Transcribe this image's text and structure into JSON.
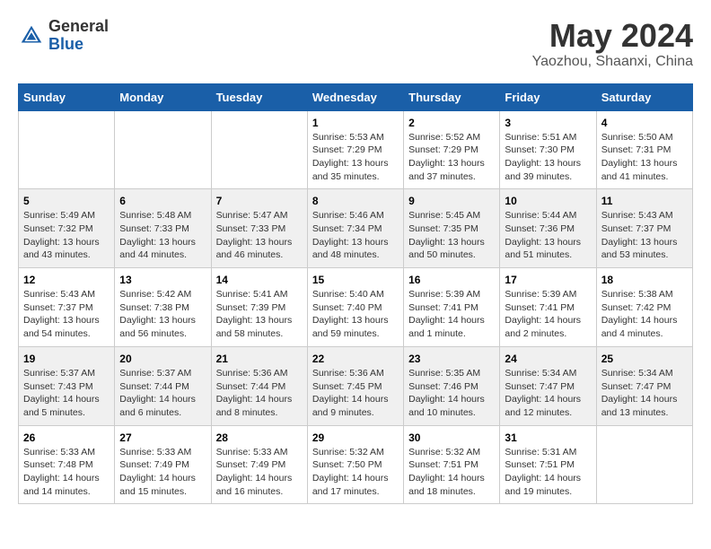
{
  "header": {
    "logo_general": "General",
    "logo_blue": "Blue",
    "main_title": "May 2024",
    "sub_title": "Yaozhou, Shaanxi, China"
  },
  "weekdays": [
    "Sunday",
    "Monday",
    "Tuesday",
    "Wednesday",
    "Thursday",
    "Friday",
    "Saturday"
  ],
  "weeks": [
    [
      {
        "day": "",
        "info": ""
      },
      {
        "day": "",
        "info": ""
      },
      {
        "day": "",
        "info": ""
      },
      {
        "day": "1",
        "info": "Sunrise: 5:53 AM\nSunset: 7:29 PM\nDaylight: 13 hours\nand 35 minutes."
      },
      {
        "day": "2",
        "info": "Sunrise: 5:52 AM\nSunset: 7:29 PM\nDaylight: 13 hours\nand 37 minutes."
      },
      {
        "day": "3",
        "info": "Sunrise: 5:51 AM\nSunset: 7:30 PM\nDaylight: 13 hours\nand 39 minutes."
      },
      {
        "day": "4",
        "info": "Sunrise: 5:50 AM\nSunset: 7:31 PM\nDaylight: 13 hours\nand 41 minutes."
      }
    ],
    [
      {
        "day": "5",
        "info": "Sunrise: 5:49 AM\nSunset: 7:32 PM\nDaylight: 13 hours\nand 43 minutes."
      },
      {
        "day": "6",
        "info": "Sunrise: 5:48 AM\nSunset: 7:33 PM\nDaylight: 13 hours\nand 44 minutes."
      },
      {
        "day": "7",
        "info": "Sunrise: 5:47 AM\nSunset: 7:33 PM\nDaylight: 13 hours\nand 46 minutes."
      },
      {
        "day": "8",
        "info": "Sunrise: 5:46 AM\nSunset: 7:34 PM\nDaylight: 13 hours\nand 48 minutes."
      },
      {
        "day": "9",
        "info": "Sunrise: 5:45 AM\nSunset: 7:35 PM\nDaylight: 13 hours\nand 50 minutes."
      },
      {
        "day": "10",
        "info": "Sunrise: 5:44 AM\nSunset: 7:36 PM\nDaylight: 13 hours\nand 51 minutes."
      },
      {
        "day": "11",
        "info": "Sunrise: 5:43 AM\nSunset: 7:37 PM\nDaylight: 13 hours\nand 53 minutes."
      }
    ],
    [
      {
        "day": "12",
        "info": "Sunrise: 5:43 AM\nSunset: 7:37 PM\nDaylight: 13 hours\nand 54 minutes."
      },
      {
        "day": "13",
        "info": "Sunrise: 5:42 AM\nSunset: 7:38 PM\nDaylight: 13 hours\nand 56 minutes."
      },
      {
        "day": "14",
        "info": "Sunrise: 5:41 AM\nSunset: 7:39 PM\nDaylight: 13 hours\nand 58 minutes."
      },
      {
        "day": "15",
        "info": "Sunrise: 5:40 AM\nSunset: 7:40 PM\nDaylight: 13 hours\nand 59 minutes."
      },
      {
        "day": "16",
        "info": "Sunrise: 5:39 AM\nSunset: 7:41 PM\nDaylight: 14 hours\nand 1 minute."
      },
      {
        "day": "17",
        "info": "Sunrise: 5:39 AM\nSunset: 7:41 PM\nDaylight: 14 hours\nand 2 minutes."
      },
      {
        "day": "18",
        "info": "Sunrise: 5:38 AM\nSunset: 7:42 PM\nDaylight: 14 hours\nand 4 minutes."
      }
    ],
    [
      {
        "day": "19",
        "info": "Sunrise: 5:37 AM\nSunset: 7:43 PM\nDaylight: 14 hours\nand 5 minutes."
      },
      {
        "day": "20",
        "info": "Sunrise: 5:37 AM\nSunset: 7:44 PM\nDaylight: 14 hours\nand 6 minutes."
      },
      {
        "day": "21",
        "info": "Sunrise: 5:36 AM\nSunset: 7:44 PM\nDaylight: 14 hours\nand 8 minutes."
      },
      {
        "day": "22",
        "info": "Sunrise: 5:36 AM\nSunset: 7:45 PM\nDaylight: 14 hours\nand 9 minutes."
      },
      {
        "day": "23",
        "info": "Sunrise: 5:35 AM\nSunset: 7:46 PM\nDaylight: 14 hours\nand 10 minutes."
      },
      {
        "day": "24",
        "info": "Sunrise: 5:34 AM\nSunset: 7:47 PM\nDaylight: 14 hours\nand 12 minutes."
      },
      {
        "day": "25",
        "info": "Sunrise: 5:34 AM\nSunset: 7:47 PM\nDaylight: 14 hours\nand 13 minutes."
      }
    ],
    [
      {
        "day": "26",
        "info": "Sunrise: 5:33 AM\nSunset: 7:48 PM\nDaylight: 14 hours\nand 14 minutes."
      },
      {
        "day": "27",
        "info": "Sunrise: 5:33 AM\nSunset: 7:49 PM\nDaylight: 14 hours\nand 15 minutes."
      },
      {
        "day": "28",
        "info": "Sunrise: 5:33 AM\nSunset: 7:49 PM\nDaylight: 14 hours\nand 16 minutes."
      },
      {
        "day": "29",
        "info": "Sunrise: 5:32 AM\nSunset: 7:50 PM\nDaylight: 14 hours\nand 17 minutes."
      },
      {
        "day": "30",
        "info": "Sunrise: 5:32 AM\nSunset: 7:51 PM\nDaylight: 14 hours\nand 18 minutes."
      },
      {
        "day": "31",
        "info": "Sunrise: 5:31 AM\nSunset: 7:51 PM\nDaylight: 14 hours\nand 19 minutes."
      },
      {
        "day": "",
        "info": ""
      }
    ]
  ]
}
